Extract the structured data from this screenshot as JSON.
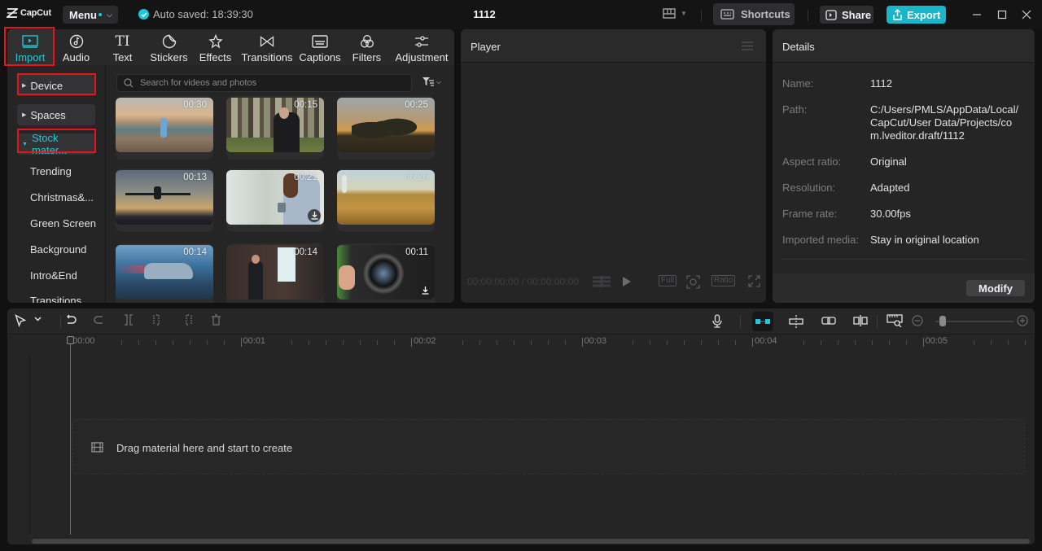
{
  "app": {
    "logo_text": "CapCut",
    "menu_label": "Menu",
    "autosave_text": "Auto saved: 18:39:30",
    "project_title": "1112",
    "shortcuts_label": "Shortcuts",
    "share_label": "Share",
    "export_label": "Export",
    "accent_color": "#1fc8d6",
    "export_color": "#1ab5c8",
    "highlight_color": "#e8141b"
  },
  "media": {
    "tabs": [
      {
        "label": "Import",
        "icon": "import-icon",
        "active": true
      },
      {
        "label": "Audio",
        "icon": "audio-icon"
      },
      {
        "label": "Text",
        "icon": "text-icon"
      },
      {
        "label": "Stickers",
        "icon": "stickers-icon"
      },
      {
        "label": "Effects",
        "icon": "effects-icon"
      },
      {
        "label": "Transitions",
        "icon": "transitions-icon"
      },
      {
        "label": "Captions",
        "icon": "captions-icon"
      },
      {
        "label": "Filters",
        "icon": "filters-icon"
      },
      {
        "label": "Adjustment",
        "icon": "adjustment-icon"
      }
    ],
    "sidebar": {
      "device": "Device",
      "spaces": "Spaces",
      "stock": "Stock mater...",
      "subitems": [
        "Trending",
        "Christmas&...",
        "Green Screen",
        "Background",
        "Intro&End",
        "Transitions"
      ]
    },
    "search_placeholder": "Search for videos and photos",
    "thumbnails": [
      {
        "duration": "00:30",
        "subject": "woman walking on beach at sunset",
        "download": false
      },
      {
        "duration": "00:15",
        "subject": "woman in forest",
        "download": false
      },
      {
        "duration": "00:25",
        "subject": "children running at sunset",
        "download": false
      },
      {
        "duration": "00:13",
        "subject": "airplane taking off",
        "download": false
      },
      {
        "duration": "00:21",
        "subject": "woman with phone and mug",
        "download": true
      },
      {
        "duration": "00:20",
        "subject": "woman in wheat field",
        "download": false
      },
      {
        "duration": "00:14",
        "subject": "car speeding",
        "download": false
      },
      {
        "duration": "00:14",
        "subject": "man presenting by screen",
        "download": false
      },
      {
        "duration": "00:11",
        "subject": "camera lens closeup",
        "download": true
      }
    ]
  },
  "player": {
    "title": "Player",
    "timecode": "00:00:00:00 / 00:00:00:00",
    "full_label": "Full",
    "ratio_label": "Ratio"
  },
  "details": {
    "title": "Details",
    "rows": [
      {
        "label": "Name:",
        "value": "1112"
      },
      {
        "label": "Path:",
        "value": "C:/Users/PMLS/AppData/Local/CapCut/User Data/Projects/com.lveditor.draft/1112"
      },
      {
        "label": "Aspect ratio:",
        "value": "Original"
      },
      {
        "label": "Resolution:",
        "value": "Adapted"
      },
      {
        "label": "Frame rate:",
        "value": "30.00fps"
      },
      {
        "label": "Imported media:",
        "value": "Stay in original location"
      }
    ],
    "modify_label": "Modify"
  },
  "timeline": {
    "ruler_labels": [
      "00:00",
      "00:01",
      "00:02",
      "00:03",
      "00:04",
      "00:05"
    ],
    "drop_text": "Drag material here and start to create",
    "zoom_level": 0.05
  }
}
